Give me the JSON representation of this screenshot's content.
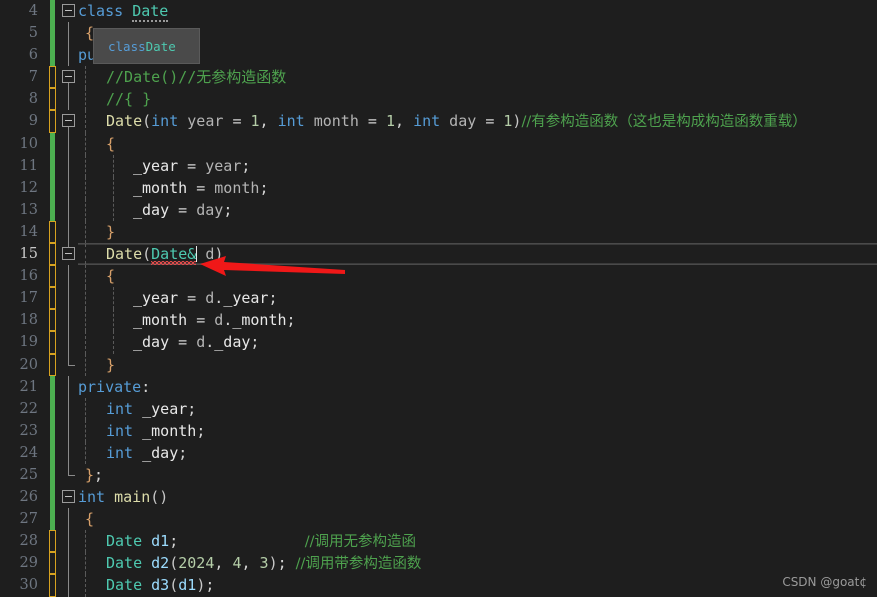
{
  "editor": {
    "theme": "dark",
    "background": "#1e1e1e",
    "watermark": "CSDN @goat¢",
    "current_line": 15,
    "gutter": {
      "first_line": 4,
      "last_line": 30
    }
  },
  "tooltip": {
    "visible": true,
    "keyword": "class",
    "typename": " Date"
  },
  "annotation": {
    "type": "red-arrow",
    "color": "#f01818",
    "points_to": "cursor after Date& on line 15"
  },
  "lines": [
    {
      "num": "4",
      "text": "class Date"
    },
    {
      "num": "5",
      "text": "{"
    },
    {
      "num": "6",
      "text": "public:"
    },
    {
      "num": "7",
      "text": "    //Date()//无参构造函数"
    },
    {
      "num": "8",
      "text": "    //{ }"
    },
    {
      "num": "9",
      "text": "    Date(int year = 1, int month = 1, int day = 1)//有参构造函数（这也是构成构造函数重载）"
    },
    {
      "num": "10",
      "text": "    {"
    },
    {
      "num": "11",
      "text": "        _year = year;"
    },
    {
      "num": "12",
      "text": "        _month = month;"
    },
    {
      "num": "13",
      "text": "        _day = day;"
    },
    {
      "num": "14",
      "text": "    }"
    },
    {
      "num": "15",
      "text": "    Date(Date& d)"
    },
    {
      "num": "16",
      "text": "    {"
    },
    {
      "num": "17",
      "text": "        _year = d._year;"
    },
    {
      "num": "18",
      "text": "        _month = d._month;"
    },
    {
      "num": "19",
      "text": "        _day = d._day;"
    },
    {
      "num": "20",
      "text": "    }"
    },
    {
      "num": "21",
      "text": "private:"
    },
    {
      "num": "22",
      "text": "    int _year;"
    },
    {
      "num": "23",
      "text": "    int _month;"
    },
    {
      "num": "24",
      "text": "    int _day;"
    },
    {
      "num": "25",
      "text": "};"
    },
    {
      "num": "26",
      "text": "int main()"
    },
    {
      "num": "27",
      "text": "{"
    },
    {
      "num": "28",
      "text": "    Date d1;              //调用无参构造函"
    },
    {
      "num": "29",
      "text": "    Date d2(2024, 4, 3); //调用带参构造函数"
    },
    {
      "num": "30",
      "text": "    Date d3(d1);"
    }
  ],
  "tokens": {
    "l4": {
      "kw": "class",
      "type": "Date"
    },
    "l5": {
      "brace": "{"
    },
    "l6": {
      "kw": "public",
      "colon": ":"
    },
    "l7": {
      "comment": "//Date()//无参构造函数"
    },
    "l8": {
      "comment": "//{ }"
    },
    "l9": {
      "func": "Date",
      "open": "(",
      "p1_type": "int",
      "p1_name": " year ",
      "eq1": "= ",
      "v1": "1",
      "c1": ", ",
      "p2_type": "int",
      "p2_name": " month ",
      "eq2": "= ",
      "v2": "1",
      "c2": ", ",
      "p3_type": "int",
      "p3_name": " day ",
      "eq3": "= ",
      "v3": "1",
      "close": ")",
      "comment": "//有参构造函数（这也是构成构造函数重载）"
    },
    "l10": {
      "brace": "{"
    },
    "l11": {
      "lhs": "_year",
      "op": " = ",
      "rhs": "year",
      "semi": ";"
    },
    "l12": {
      "lhs": "_month",
      "op": " = ",
      "rhs": "month",
      "semi": ";"
    },
    "l13": {
      "lhs": "_day",
      "op": " = ",
      "rhs": "day",
      "semi": ";"
    },
    "l14": {
      "brace": "}"
    },
    "l15": {
      "func": "Date",
      "open": "(",
      "ptype": "Date&",
      "pname": " d",
      "close": ")"
    },
    "l16": {
      "brace": "{"
    },
    "l17": {
      "lhs": "_year",
      "op": " = ",
      "obj": "d",
      "dot": ".",
      "mem": "_year",
      "semi": ";"
    },
    "l18": {
      "lhs": "_month",
      "op": " = ",
      "obj": "d",
      "dot": ".",
      "mem": "_month",
      "semi": ";"
    },
    "l19": {
      "lhs": "_day",
      "op": " = ",
      "obj": "d",
      "dot": ".",
      "mem": "_day",
      "semi": ";"
    },
    "l20": {
      "brace": "}"
    },
    "l21": {
      "kw": "private",
      "colon": ":"
    },
    "l22": {
      "type": "int",
      "name": " _year",
      "semi": ";"
    },
    "l23": {
      "type": "int",
      "name": " _month",
      "semi": ";"
    },
    "l24": {
      "type": "int",
      "name": " _day",
      "semi": ";"
    },
    "l25": {
      "brace": "}",
      "semi": ";"
    },
    "l26": {
      "type": "int",
      "name": " main",
      "parens": "()"
    },
    "l27": {
      "brace": "{"
    },
    "l28": {
      "type": "Date",
      "name": " d1",
      "semi": ";",
      "pad": "              ",
      "comment": "//调用无参构造函"
    },
    "l29": {
      "type": "Date",
      "name": " d2",
      "open": "(",
      "a1": "2024",
      "c1": ", ",
      "a2": "4",
      "c2": ", ",
      "a3": "3",
      "close": ")",
      "semi": ";",
      "pad": " ",
      "comment": "//调用带参构造函数"
    },
    "l30": {
      "type": "Date",
      "name": " d3",
      "open": "(",
      "arg": "d1",
      "close": ")",
      "semi": ";"
    }
  }
}
